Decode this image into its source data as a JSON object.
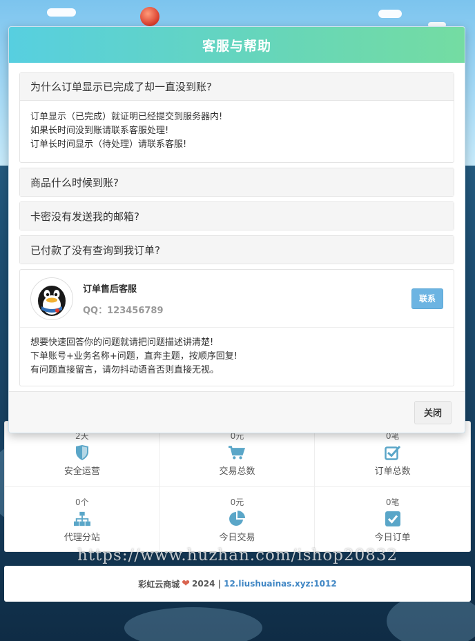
{
  "modal": {
    "title": "客服与帮助",
    "faqs": [
      {
        "question": "为什么订单显示已完成了却一直没到账?",
        "answer_lines": [
          "订单显示（已完成）就证明已经提交到服务器内!",
          "如果长时间没到账请联系客服处理!",
          "订单长时间显示（待处理）请联系客服!"
        ]
      },
      {
        "question": "商品什么时候到账?"
      },
      {
        "question": "卡密没有发送我的邮箱?"
      },
      {
        "question": "已付款了没有查询到我订单?"
      }
    ],
    "service": {
      "name": "订单售后客服",
      "qq": "QQ：123456789",
      "contact_label": "联系",
      "avatar_icon": "qq-penguin-icon",
      "note_lines": [
        "想要快速回答你的问题就请把问题描述讲清楚!",
        "下单账号+业务名称+问题，直奔主题，按顺序回复!",
        "有问题直接留言，请勿抖动语音否则直接无视。"
      ]
    },
    "close_label": "关闭"
  },
  "stats": [
    {
      "value": "2天",
      "label": "安全运营",
      "icon": "shield-icon"
    },
    {
      "value": "0元",
      "label": "交易总数",
      "icon": "cart-icon"
    },
    {
      "value": "0笔",
      "label": "订单总数",
      "icon": "check-edit-icon"
    },
    {
      "value": "0个",
      "label": "代理分站",
      "icon": "sitemap-icon"
    },
    {
      "value": "0元",
      "label": "今日交易",
      "icon": "pie-chart-icon"
    },
    {
      "value": "0笔",
      "label": "今日订单",
      "icon": "check-square-icon"
    }
  ],
  "footer": {
    "brand": "彩虹云商城",
    "year": "2024 |",
    "link": "12.liushuainas.xyz:1012"
  },
  "watermark": "https://www.huzhan.com/ishop20832",
  "colors": {
    "accent": "#6cb4e2",
    "icon": "#5aa6c8",
    "header_start": "#57cfe0",
    "header_end": "#74dca2",
    "heart": "#d9634f"
  }
}
